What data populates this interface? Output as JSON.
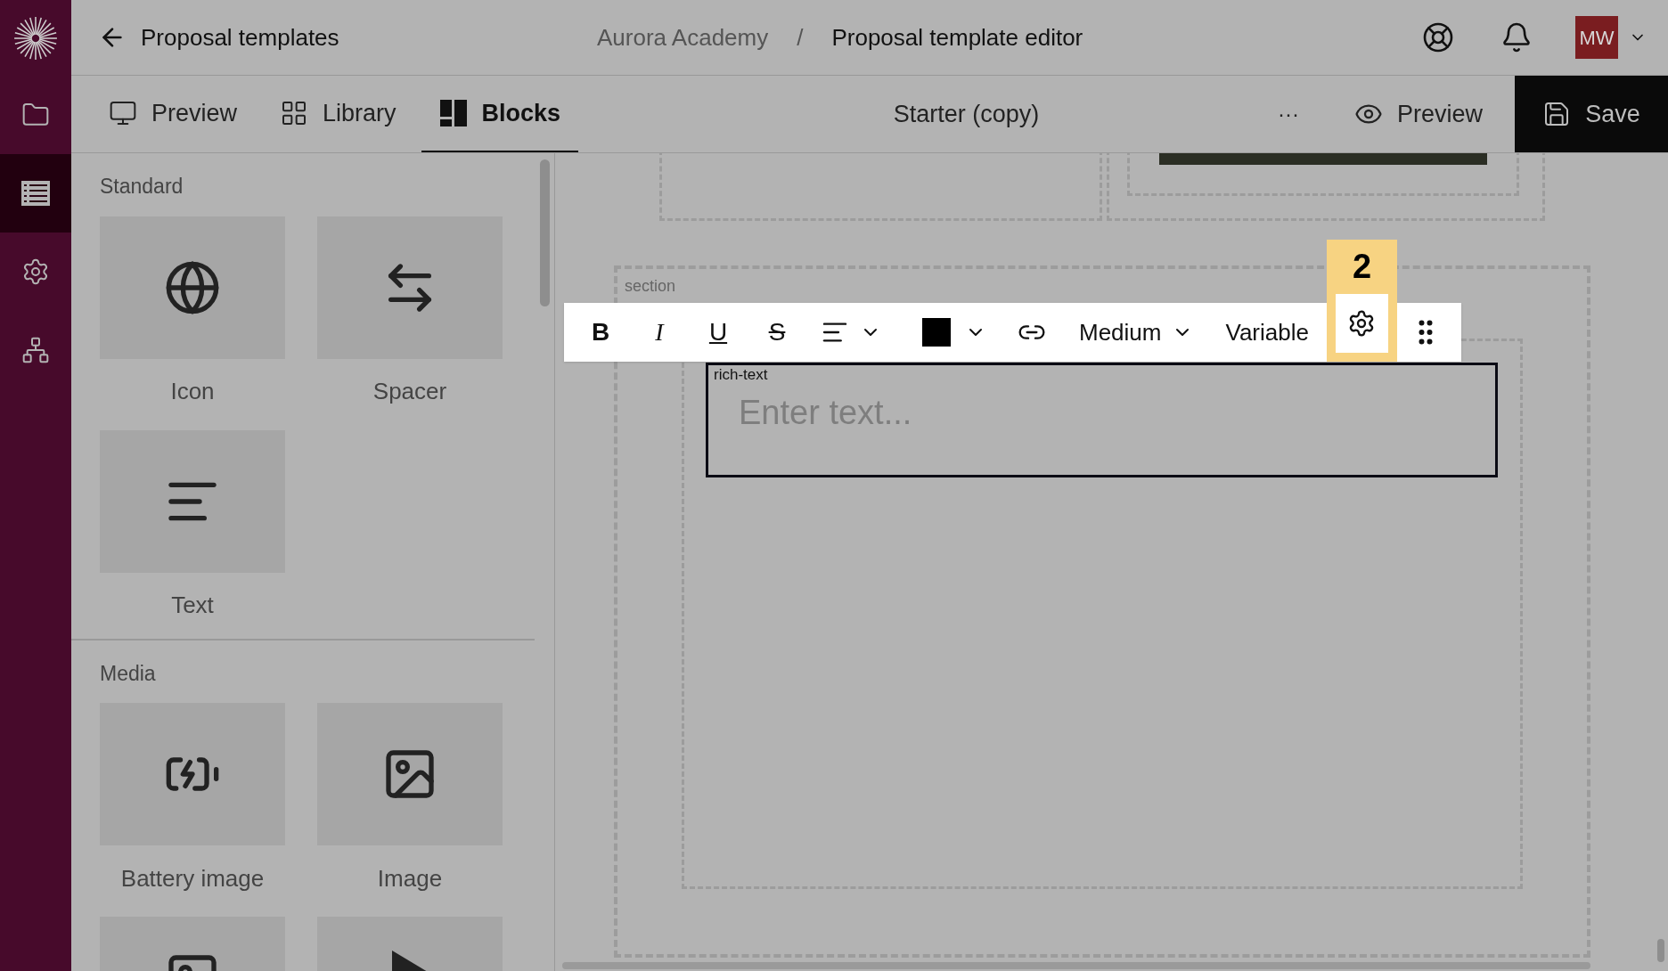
{
  "nav": {
    "items": [
      {
        "kind": "folder",
        "selected": false
      },
      {
        "kind": "list",
        "selected": true
      },
      {
        "kind": "settings",
        "selected": false
      },
      {
        "kind": "hierarchy",
        "selected": false
      }
    ]
  },
  "header": {
    "back_label": "Proposal templates",
    "breadcrumb": [
      "Aurora Academy",
      "Proposal template editor"
    ],
    "separator": "/",
    "avatar": "MW"
  },
  "tabs": [
    {
      "label": "Preview",
      "kind": "preview",
      "selected": false
    },
    {
      "label": "Library",
      "kind": "library",
      "selected": false
    },
    {
      "label": "Blocks",
      "kind": "blocks",
      "selected": true
    }
  ],
  "document_title": "Starter (copy)",
  "more": "···",
  "actions": {
    "preview": "Preview",
    "save": "Save"
  },
  "panel": {
    "sections": [
      {
        "title": "Standard",
        "blocks": [
          {
            "label": "Icon",
            "kind": "globe"
          },
          {
            "label": "Spacer",
            "kind": "arrows"
          },
          {
            "label": "Text",
            "kind": "lines"
          }
        ]
      },
      {
        "title": "Media",
        "blocks": [
          {
            "label": "Battery image",
            "kind": "battery"
          },
          {
            "label": "Image",
            "kind": "image"
          },
          {
            "kind": "picture"
          },
          {
            "kind": "play"
          }
        ]
      }
    ]
  },
  "canvas": {
    "section_label": "section",
    "element_label": "rich-text",
    "placeholder": "Enter text..."
  },
  "toolbar": {
    "items": [
      {
        "kind": "bold",
        "text": "B"
      },
      {
        "kind": "italic",
        "text": "I"
      },
      {
        "kind": "underline",
        "text": "U"
      },
      {
        "kind": "strike",
        "text": "S"
      },
      {
        "kind": "align"
      },
      {
        "kind": "color",
        "color": "#000000"
      },
      {
        "kind": "link"
      },
      {
        "kind": "size",
        "text": "Medium"
      },
      {
        "kind": "variable",
        "text": "Variable"
      },
      {
        "kind": "settings",
        "highlight": "2"
      },
      {
        "kind": "drag"
      }
    ]
  }
}
